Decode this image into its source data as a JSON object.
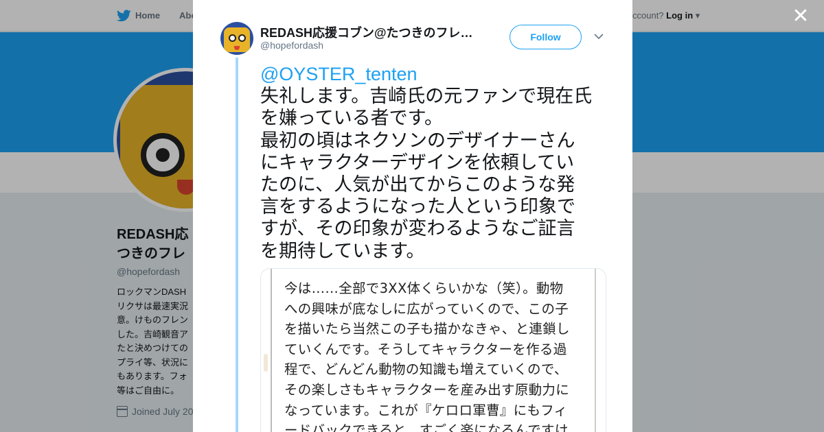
{
  "topnav": {
    "home_label": "Home",
    "about_label": "Abo",
    "account_prompt": "ccount?",
    "login_label": "Log in"
  },
  "profile": {
    "name": "REDASH応\nつきのフレ",
    "handle": "@hopefordash",
    "bio": "ロックマンDASH\nリクサは最速実況\n意。けものフレン\nした。吉崎観音ア\nたと決めつけての\nプライ等、状況に\nもあります。フォ\n等はご自由に。",
    "joined": "Joined July 20"
  },
  "modal": {
    "close_glyph": "✕",
    "author_name": "REDASH応援コブン@たつきのフレ…",
    "author_handle": "@hopefordash",
    "follow_label": "Follow",
    "tweet": {
      "mention": "@OYSTER_tenten",
      "text": "失礼します。吉崎氏の元ファンで現在氏\nを嫌っている者です。\n最初の頃はネクソンのデザイナーさん\nにキャラクターデザインを依頼してい\nたのに、人気が出てからこのような発\n言をするようになった人という印象で\nすが、その印象が変わるようなご証言\nを期待しています。"
    },
    "media_text": "今は……全部で3XX体くらいかな（笑）。動物\nへの興味が底なしに広がっていくので、この子\nを描いたら当然この子も描かなきゃ、と連鎖し\nていくんです。そうしてキャラクターを作る過\n程で、どんどん動物の知識も増えていくので、\nその楽しさもキャラクターを産み出す原動力に\nなっています。これが『ケロロ軍曹』にもフィ\nードバックできると、すごく楽になるんですけ"
  },
  "colors": {
    "brand_blue": "#1da1f2",
    "thread_line": "#a6d8f9"
  },
  "icons": [
    "twitter-bird-icon",
    "calendar-icon",
    "close-icon",
    "chevron-down-icon"
  ]
}
